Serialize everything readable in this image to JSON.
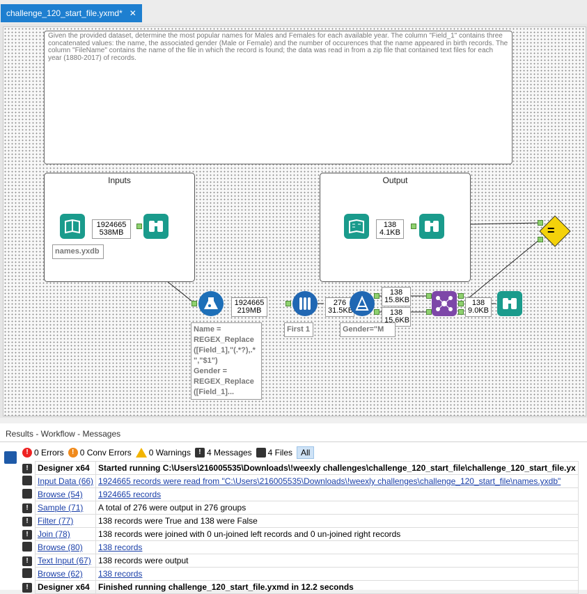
{
  "tab": {
    "title": "challenge_120_start_file.yxmd*",
    "close": "✕"
  },
  "comment": "Given the provided dataset, determine the most popular names for Males and Females for each available year.  The column \"Field_1\" contains three concatenated values: the name, the associated gender (Male or Female) and the number of occurences that the name appeared in birth records.   The column \"FileName\" contains the name of the file in which the record is found; the data was read in from a zip file that contained text files for each year (1880-2017) of records.",
  "containers": {
    "inputs": "Inputs",
    "output": "Output"
  },
  "counts": {
    "input": [
      "1924665",
      "538MB"
    ],
    "output": [
      "138",
      "4.1KB"
    ],
    "formula": [
      "1924665",
      "219MB"
    ],
    "sample": [
      "276",
      "31.5KB"
    ],
    "filter_true": [
      "138",
      "15.8KB"
    ],
    "filter_false": [
      "138",
      "15.6KB"
    ],
    "join": [
      "138",
      "9.0KB"
    ]
  },
  "annotations": {
    "input": "names.yxdb",
    "formula": "Name =\nREGEX_Replace\n([Field_1],\"(.*?),.*\n\",\"$1\")\nGender =\nREGEX_Replace\n([Field_1]...",
    "sample": "First 1",
    "filter": "Gender=\"M"
  },
  "results": {
    "title": "Results - Workflow - Messages",
    "filters": {
      "errors": "0 Errors",
      "conv_errors": "0 Conv Errors",
      "warnings": "0 Warnings",
      "messages": "4 Messages",
      "files": "4 Files",
      "all": "All"
    },
    "rows": [
      {
        "tool": "Designer x64",
        "msg": "Started running C:\\Users\\216005535\\Downloads\\!weexly challenges\\challenge_120_start_file\\challenge_120_start_file.yx",
        "bold": true,
        "tool_link": false,
        "msg_link": false,
        "icon": "msg"
      },
      {
        "tool": "Input Data (66)",
        "msg": "1924665 records were read from \"C:\\Users\\216005535\\Downloads\\!weexly challenges\\challenge_120_start_file\\names.yxdb\"",
        "bold": false,
        "tool_link": true,
        "msg_link": true,
        "icon": "folder"
      },
      {
        "tool": "Browse (54)",
        "msg": "1924665 records",
        "bold": false,
        "tool_link": true,
        "msg_link": true,
        "icon": "file"
      },
      {
        "tool": "Sample (71)",
        "msg": "A total of 276 were output in 276 groups",
        "bold": false,
        "tool_link": true,
        "msg_link": false,
        "icon": "msg"
      },
      {
        "tool": "Filter (77)",
        "msg": "138 records were True and 138 were False",
        "bold": false,
        "tool_link": true,
        "msg_link": false,
        "icon": "msg"
      },
      {
        "tool": "Join (78)",
        "msg": "138 records were joined with 0 un-joined left records and 0 un-joined right records",
        "bold": false,
        "tool_link": true,
        "msg_link": false,
        "icon": "msg"
      },
      {
        "tool": "Browse (80)",
        "msg": "138 records",
        "bold": false,
        "tool_link": true,
        "msg_link": true,
        "icon": "file"
      },
      {
        "tool": "Text Input (67)",
        "msg": "138 records were output",
        "bold": false,
        "tool_link": true,
        "msg_link": false,
        "icon": "msg"
      },
      {
        "tool": "Browse (62)",
        "msg": "138 records",
        "bold": false,
        "tool_link": true,
        "msg_link": true,
        "icon": "file"
      },
      {
        "tool": "Designer x64",
        "msg": "Finished running challenge_120_start_file.yxmd in 12.2 seconds",
        "bold": true,
        "tool_link": false,
        "msg_link": false,
        "icon": "msg"
      }
    ]
  }
}
